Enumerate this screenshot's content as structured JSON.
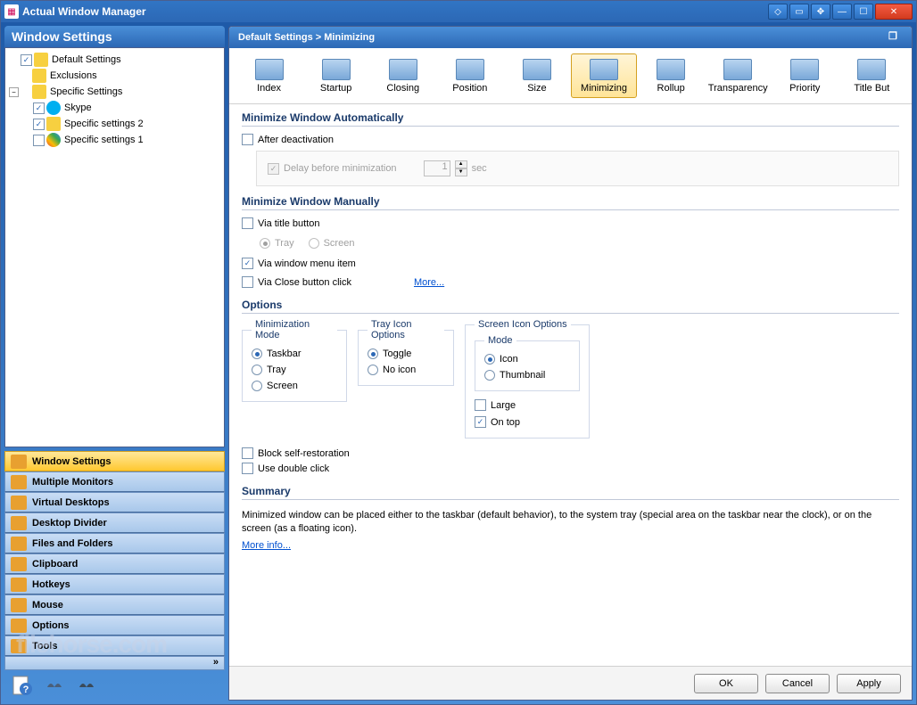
{
  "titlebar": {
    "title": "Actual Window Manager"
  },
  "left": {
    "header": "Window Settings",
    "tree": {
      "default_settings": "Default Settings",
      "exclusions": "Exclusions",
      "specific_settings": "Specific Settings",
      "skype": "Skype",
      "specific2": "Specific settings 2",
      "specific1": "Specific settings 1"
    },
    "nav": {
      "window_settings": "Window Settings",
      "multiple_monitors": "Multiple Monitors",
      "virtual_desktops": "Virtual Desktops",
      "desktop_divider": "Desktop Divider",
      "files_folders": "Files and Folders",
      "clipboard": "Clipboard",
      "hotkeys": "Hotkeys",
      "mouse": "Mouse",
      "options": "Options",
      "tools": "Tools"
    }
  },
  "breadcrumb": "Default Settings > Minimizing",
  "toolbar": {
    "index": "Index",
    "startup": "Startup",
    "closing": "Closing",
    "position": "Position",
    "size": "Size",
    "minimizing": "Minimizing",
    "rollup": "Rollup",
    "transparency": "Transparency",
    "priority": "Priority",
    "title_but": "Title But"
  },
  "content": {
    "sec_auto": "Minimize Window Automatically",
    "after_deactivation": "After deactivation",
    "delay_before": "Delay before minimization",
    "delay_value": "1",
    "delay_unit": "sec",
    "sec_manual": "Minimize Window Manually",
    "via_title": "Via title button",
    "tray": "Tray",
    "screen": "Screen",
    "via_menu": "Via window menu item",
    "via_close": "Via Close button click",
    "more": "More...",
    "sec_options": "Options",
    "min_mode_legend": "Minimization Mode",
    "taskbar": "Taskbar",
    "tray2": "Tray",
    "screen2": "Screen",
    "tray_icon_legend": "Tray Icon Options",
    "toggle": "Toggle",
    "no_icon": "No icon",
    "screen_icon_legend": "Screen Icon Options",
    "mode_legend": "Mode",
    "icon": "Icon",
    "thumbnail": "Thumbnail",
    "large": "Large",
    "on_top": "On top",
    "block_self": "Block self-restoration",
    "use_double": "Use double click",
    "sec_summary": "Summary",
    "summary_text": "Minimized window can be placed either to the taskbar (default behavior), to the system tray (special area on the taskbar near the clock), or on the screen (as a floating icon).",
    "more_info": "More info..."
  },
  "buttons": {
    "ok": "OK",
    "cancel": "Cancel",
    "apply": "Apply"
  },
  "watermark": "filehorse.com"
}
